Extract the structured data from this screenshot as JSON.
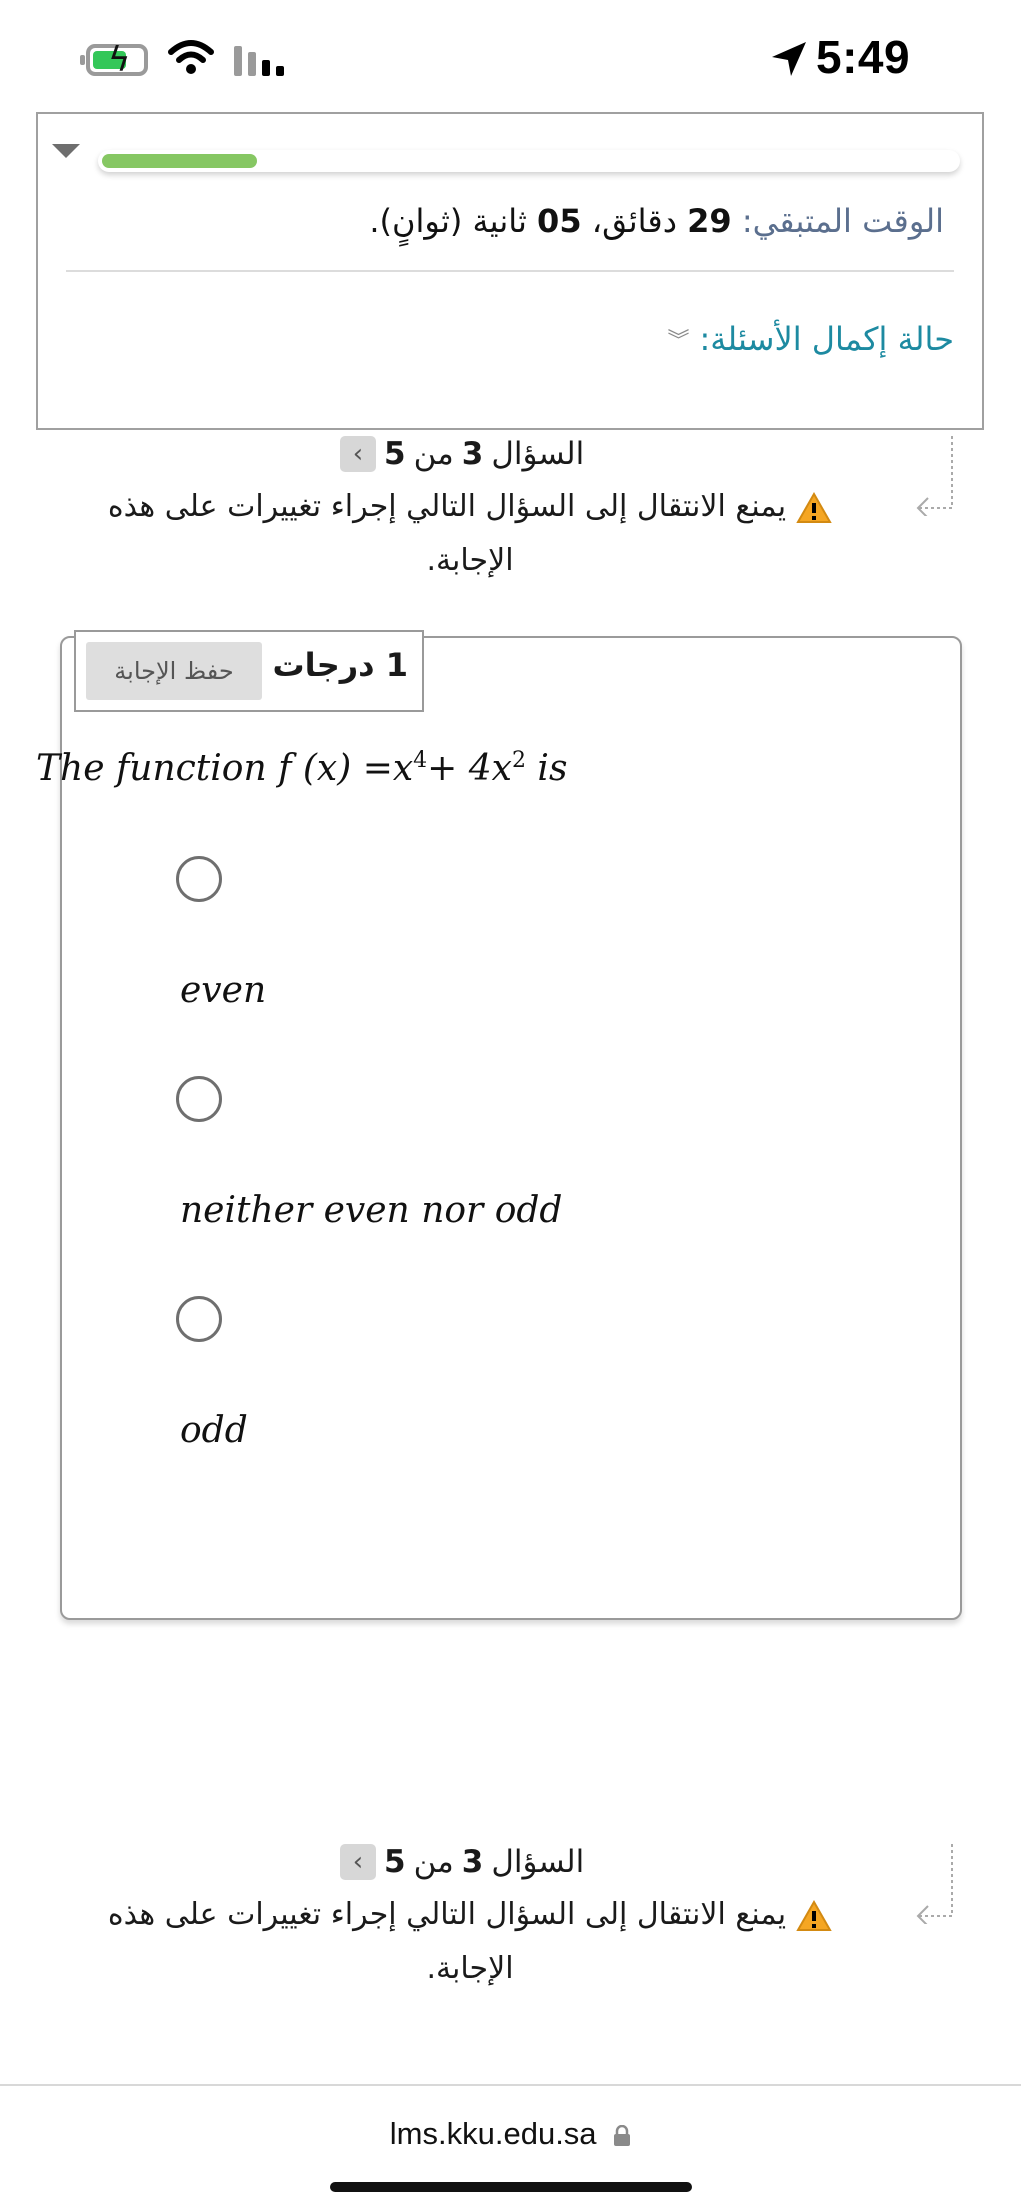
{
  "status_bar": {
    "time": "5:49",
    "icons": [
      "battery-charging-icon",
      "wifi-icon",
      "cellular-signal-icon",
      "location-arrow-icon"
    ]
  },
  "timer_panel": {
    "progress_fraction": 0.18,
    "time_label": "الوقت المتبقي:",
    "minutes_value": "29",
    "minutes_word": "دقائق،",
    "seconds_value": "05",
    "seconds_word": "ثانية (ثوانٍ).",
    "completion_status": "حالة إكمال الأسئلة:"
  },
  "navigation": {
    "question_word": "السؤال",
    "current": "3",
    "of_word": "من",
    "total": "5",
    "warning": "يمنع الانتقال إلى السؤال التالي إجراء تغييرات على هذه الإجابة."
  },
  "question": {
    "points": "1 درجات",
    "save_answer": "حفظ الإجابة",
    "text_before": "The function f (x) =x",
    "exp1": "4",
    "text_mid": "+ 4x",
    "exp2": "2",
    "text_after": " is",
    "options": [
      {
        "label": "even",
        "selected": false
      },
      {
        "label": "neither even nor odd",
        "selected": false
      },
      {
        "label": "odd",
        "selected": false
      }
    ]
  },
  "browser": {
    "url": "lms.kku.edu.sa"
  },
  "colors": {
    "progress_green": "#86c763",
    "timer_label": "#5b6f8e",
    "completion_link": "#1d8aa1",
    "warning_orange": "#f5a623"
  }
}
